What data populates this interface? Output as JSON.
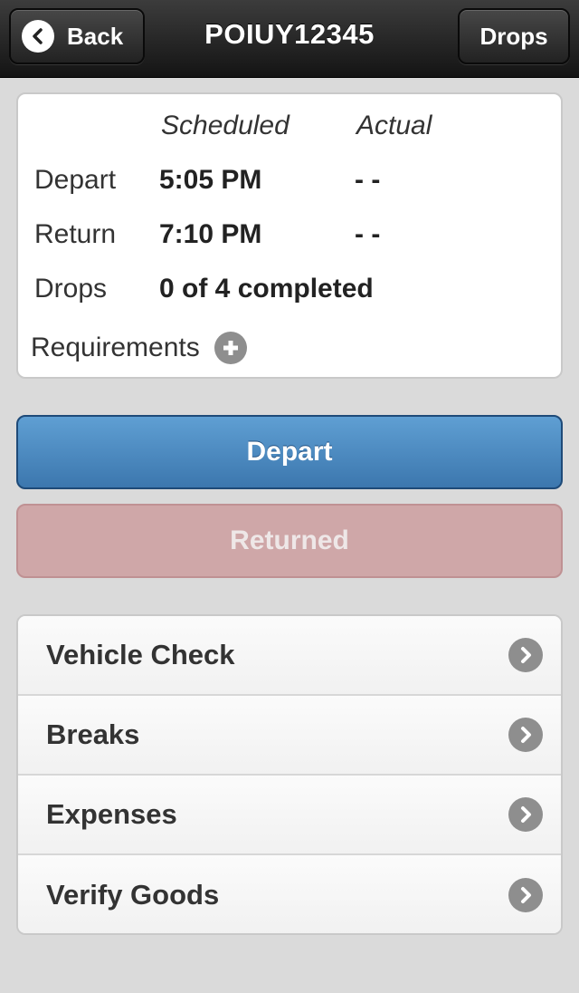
{
  "header": {
    "title": "POIUY12345",
    "back_label": "Back",
    "drops_label": "Drops"
  },
  "summary": {
    "col_scheduled": "Scheduled",
    "col_actual": "Actual",
    "rows": [
      {
        "label": "Depart",
        "scheduled": "5:05 PM",
        "actual": "- -"
      },
      {
        "label": "Return",
        "scheduled": "7:10 PM",
        "actual": "- -"
      },
      {
        "label": "Drops",
        "value": "0 of 4 completed"
      }
    ],
    "requirements_label": "Requirements"
  },
  "actions": {
    "depart_label": "Depart",
    "returned_label": "Returned"
  },
  "menu": {
    "items": [
      {
        "label": "Vehicle Check"
      },
      {
        "label": "Breaks"
      },
      {
        "label": "Expenses"
      },
      {
        "label": "Verify Goods"
      }
    ]
  },
  "colors": {
    "depart_button": "#4a8bc4",
    "returned_button": "#cfa7a8",
    "header_bg": "#2a2a2a",
    "page_bg": "#dadada"
  },
  "icons": {
    "back": "chevron-left-icon",
    "requirements": "plus-circle-icon",
    "list_item": "chevron-right-icon"
  }
}
